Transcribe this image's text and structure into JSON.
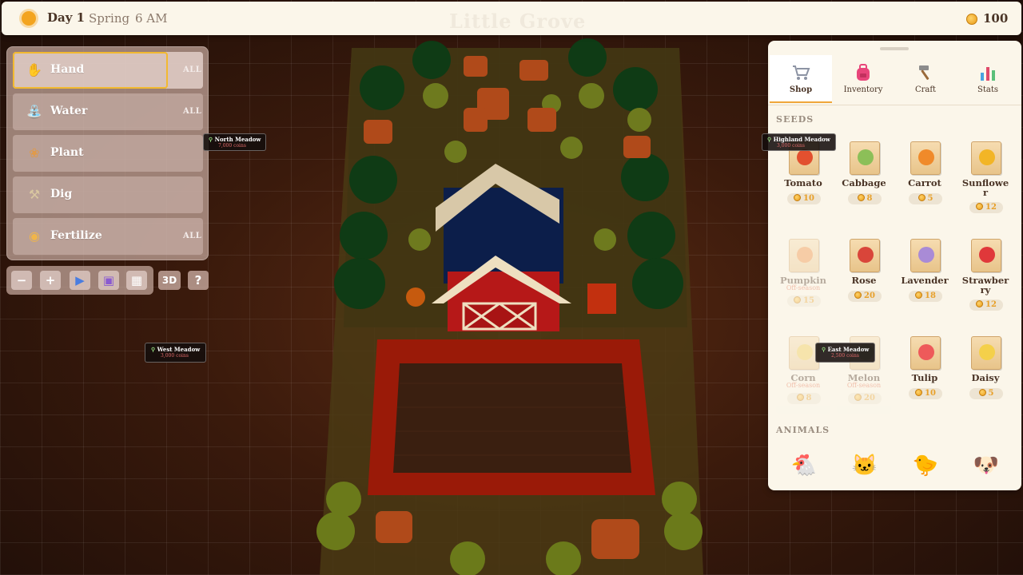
{
  "hud": {
    "day": "Day 1",
    "season": "Spring",
    "time": "6 AM",
    "title": "Little Grove",
    "coins": "100"
  },
  "tools": [
    {
      "label": "Hand",
      "all": "ALL",
      "icon": "hand-icon"
    },
    {
      "label": "Water",
      "all": "ALL",
      "icon": "watering-can-icon"
    },
    {
      "label": "Plant",
      "all": "",
      "icon": "seed-bag-icon"
    },
    {
      "label": "Dig",
      "all": "",
      "icon": "shovel-icon"
    },
    {
      "label": "Fertilize",
      "all": "ALL",
      "icon": "fertilizer-sack-icon"
    }
  ],
  "toolbar": {
    "zoom_out": "−",
    "zoom_in": "+",
    "view_3d": "3D",
    "help": "?"
  },
  "map_labels": {
    "north": {
      "name": "North Meadow",
      "cost": "7,000 coins"
    },
    "west": {
      "name": "West Meadow",
      "cost": "3,000 coins"
    },
    "highland": {
      "name": "Highland Meadow",
      "cost": "3,000 coins"
    },
    "east": {
      "name": "East Meadow",
      "cost": "2,500 coins"
    }
  },
  "tabs": [
    {
      "label": "Shop",
      "icon": "shopping-cart-icon"
    },
    {
      "label": "Inventory",
      "icon": "backpack-icon"
    },
    {
      "label": "Craft",
      "icon": "hammer-icon"
    },
    {
      "label": "Stats",
      "icon": "bar-chart-icon"
    }
  ],
  "shop": {
    "seeds_title": "SEEDS",
    "animals_title": "ANIMALS",
    "seeds": [
      {
        "name": "Tomato",
        "price": "10",
        "status": "",
        "color": "#e2502f"
      },
      {
        "name": "Cabbage",
        "price": "8",
        "status": "",
        "color": "#8cbf58"
      },
      {
        "name": "Carrot",
        "price": "5",
        "status": "",
        "color": "#f08a2a"
      },
      {
        "name": "Sunflower",
        "price": "12",
        "status": "",
        "color": "#f2b526"
      },
      {
        "name": "Pumpkin",
        "price": "15",
        "status": "Off-season",
        "color": "#f08a3a"
      },
      {
        "name": "Rose",
        "price": "20",
        "status": "",
        "color": "#d9453a"
      },
      {
        "name": "Lavender",
        "price": "18",
        "status": "",
        "color": "#a98bd6"
      },
      {
        "name": "Strawberry",
        "price": "12",
        "status": "",
        "color": "#e0383a"
      },
      {
        "name": "Corn",
        "price": "8",
        "status": "Off-season",
        "color": "#f0c84a"
      },
      {
        "name": "Melon",
        "price": "20",
        "status": "Off-season",
        "color": "#7fb850"
      },
      {
        "name": "Tulip",
        "price": "10",
        "status": "",
        "color": "#ee5a5a"
      },
      {
        "name": "Daisy",
        "price": "5",
        "status": "",
        "color": "#f4d04a"
      }
    ],
    "animals": [
      {
        "icon": "chicken-icon",
        "glyph": "🐔"
      },
      {
        "icon": "cat-icon",
        "glyph": "🐱"
      },
      {
        "icon": "duck-icon",
        "glyph": "🐤"
      },
      {
        "icon": "dog-icon",
        "glyph": "🐶"
      }
    ]
  },
  "colors": {
    "accent": "#f0a63a",
    "panel_bg": "#fbf6ea",
    "selected_border": "#f2b930",
    "off_season": "#e26a4a",
    "coin": "#e8a02a"
  }
}
